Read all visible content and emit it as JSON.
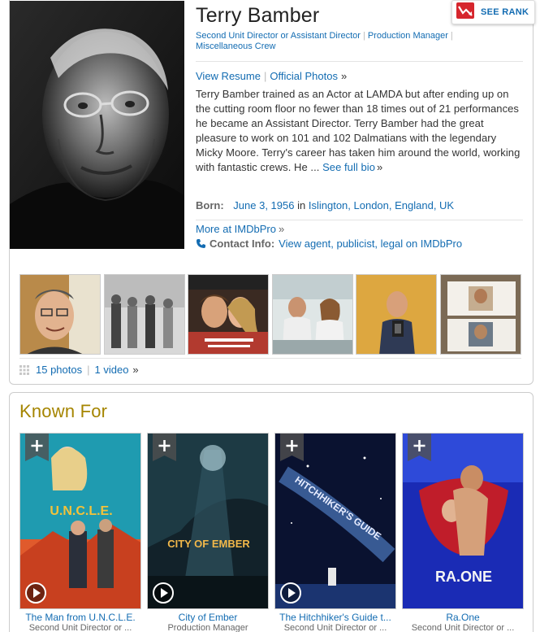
{
  "person": {
    "name": "Terry Bamber",
    "categories": [
      "Second Unit Director or Assistant Director",
      "Production Manager",
      "Miscellaneous Crew"
    ],
    "view_resume": "View Resume",
    "official_photos": "Official Photos",
    "raquo": "»",
    "bio_text": "Terry Bamber trained as an Actor at LAMDA but after ending up on the cutting room floor no fewer than 18 times out of 21 performances he became an Assistant Director. Terry Bamber had the great pleasure to work on 101 and 102 Dalmatians with the legendary Micky Moore. Terry's career has taken him around the world, working with fantastic crews. He ...",
    "see_full_bio": "See full bio",
    "born_label": "Born:",
    "born_date": "June 3, 1956",
    "born_in": "in",
    "born_place": "Islington, London, England, UK",
    "more_imdbpro": "More at IMDbPro",
    "contact_label": "Contact Info:",
    "contact_link": "View agent, publicist, legal on IMDbPro"
  },
  "rank_button": {
    "label": "SEE RANK"
  },
  "photo_strip": {
    "thumbnails": [
      {
        "icon": "photo-man-smiling"
      },
      {
        "icon": "photo-bw-group"
      },
      {
        "icon": "photo-poster-collage"
      },
      {
        "icon": "photo-two-people-table"
      },
      {
        "icon": "photo-mirror-selfie"
      },
      {
        "icon": "photo-framed-pictures"
      }
    ]
  },
  "media_links": {
    "photos": "15 photos",
    "video": "1 video",
    "raquo": "»"
  },
  "known_for": {
    "heading": "Known For",
    "items": [
      {
        "title": "The Man from U.N.C.L.E.",
        "role": "Second Unit Director or ...",
        "poster_text": "U.N.C.L.E.",
        "accent": "#e8552f"
      },
      {
        "title": "City of Ember",
        "role": "Production Manager",
        "poster_text": "CITY OF EMBER",
        "accent": "#d9a03a"
      },
      {
        "title": "The Hitchhiker's Guide t...",
        "role": "Second Unit Director or ...",
        "poster_text": "HITCHHIKER'S GUIDE",
        "accent": "#4a78c8"
      },
      {
        "title": "Ra.One",
        "role": "Second Unit Director or ...",
        "poster_text": "RA.ONE",
        "accent": "#c8202a"
      }
    ]
  },
  "colors": {
    "link": "#136cb2",
    "heading_gold": "#a58500",
    "rank_red": "#d6262d"
  }
}
